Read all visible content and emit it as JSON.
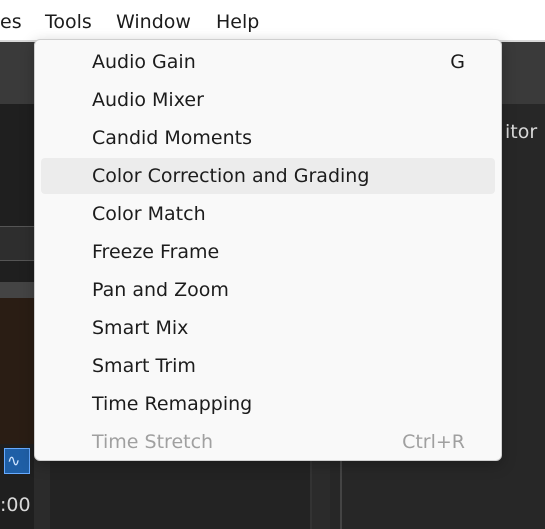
{
  "menubar": {
    "items": [
      "es",
      "Tools",
      "Window",
      "Help"
    ]
  },
  "background": {
    "right_panel_label": "itor",
    "timecode": ":00"
  },
  "tools_menu": {
    "items": [
      {
        "label": "Audio Gain",
        "shortcut": "G",
        "state": "normal"
      },
      {
        "label": "Audio Mixer",
        "shortcut": "",
        "state": "normal"
      },
      {
        "label": "Candid Moments",
        "shortcut": "",
        "state": "normal"
      },
      {
        "label": "Color Correction and Grading",
        "shortcut": "",
        "state": "hover"
      },
      {
        "label": "Color Match",
        "shortcut": "",
        "state": "normal"
      },
      {
        "label": "Freeze Frame",
        "shortcut": "",
        "state": "normal"
      },
      {
        "label": "Pan and Zoom",
        "shortcut": "",
        "state": "normal"
      },
      {
        "label": "Smart Mix",
        "shortcut": "",
        "state": "normal"
      },
      {
        "label": "Smart Trim",
        "shortcut": "",
        "state": "normal"
      },
      {
        "label": "Time Remapping",
        "shortcut": "",
        "state": "normal"
      },
      {
        "label": "Time Stretch",
        "shortcut": "Ctrl+R",
        "state": "disabled"
      }
    ]
  },
  "colors": {
    "menu_bg": "#f9f9f9",
    "hover_bg": "#ececec",
    "disabled_text": "#a0a0a0",
    "app_dark": "#1f1f1f"
  }
}
